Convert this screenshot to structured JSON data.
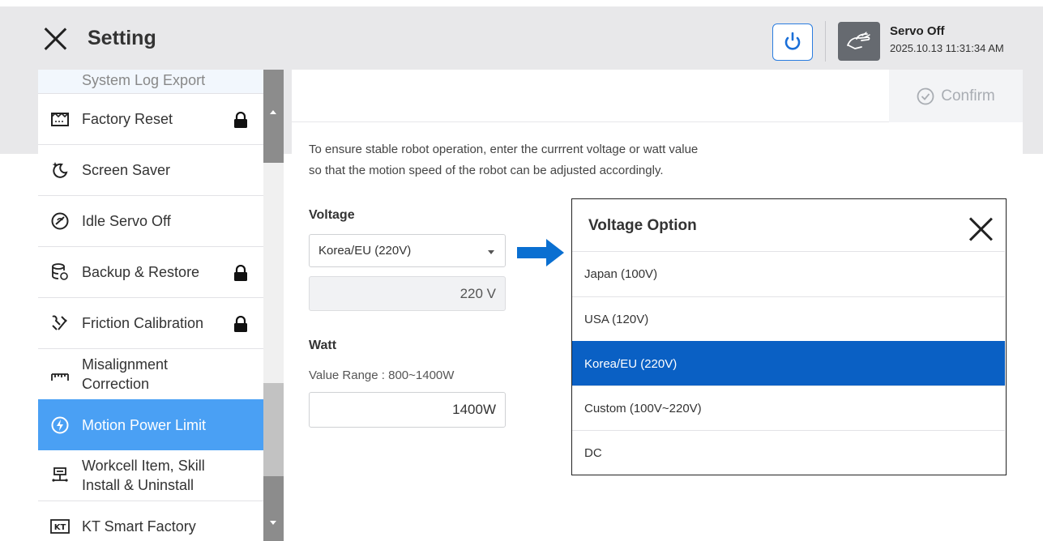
{
  "header": {
    "title": "Setting",
    "servo_status": "Servo Off",
    "datetime": "2025.10.13 11:31:34 AM"
  },
  "sidebar": {
    "items": [
      {
        "label": "System Log Export",
        "icon": "export-icon",
        "locked": false
      },
      {
        "label": "Factory Reset",
        "icon": "factory-icon",
        "locked": true
      },
      {
        "label": "Screen Saver",
        "icon": "screen-saver-icon",
        "locked": false
      },
      {
        "label": "Idle Servo Off",
        "icon": "idle-servo-icon",
        "locked": false
      },
      {
        "label": "Backup & Restore",
        "icon": "database-icon",
        "locked": true
      },
      {
        "label": "Friction Calibration",
        "icon": "calibration-icon",
        "locked": true
      },
      {
        "label_line1": "Misalignment",
        "label_line2": "Correction",
        "icon": "ruler-icon",
        "locked": false
      },
      {
        "label": "Motion Power Limit",
        "icon": "power-limit-icon",
        "locked": false,
        "active": true
      },
      {
        "label_line1": "Workcell Item, Skill",
        "label_line2": "Install & Uninstall",
        "icon": "workcell-icon",
        "locked": false
      },
      {
        "label": "KT Smart Factory",
        "icon": "kt-icon",
        "locked": false
      }
    ]
  },
  "panel": {
    "confirm_label": "Confirm",
    "description_line1": "To ensure stable robot operation, enter the currrent voltage or watt value",
    "description_line2": "so that the motion speed of the robot can be adjusted accordingly.",
    "voltage_label": "Voltage",
    "voltage_selected": "Korea/EU (220V)",
    "voltage_value": "220 V",
    "watt_label": "Watt",
    "watt_range": "Value Range : 800~1400W",
    "watt_value": "1400W"
  },
  "popup": {
    "title": "Voltage Option",
    "options": [
      "Japan (100V)",
      "USA (120V)",
      "Korea/EU (220V)",
      "Custom (100V~220V)",
      "DC"
    ],
    "selected": "Korea/EU (220V)"
  },
  "colors": {
    "accent": "#4aa0f4",
    "selected": "#0a60c4",
    "arrow": "#0a6fd1",
    "header_bg": "#e8e8ea"
  }
}
